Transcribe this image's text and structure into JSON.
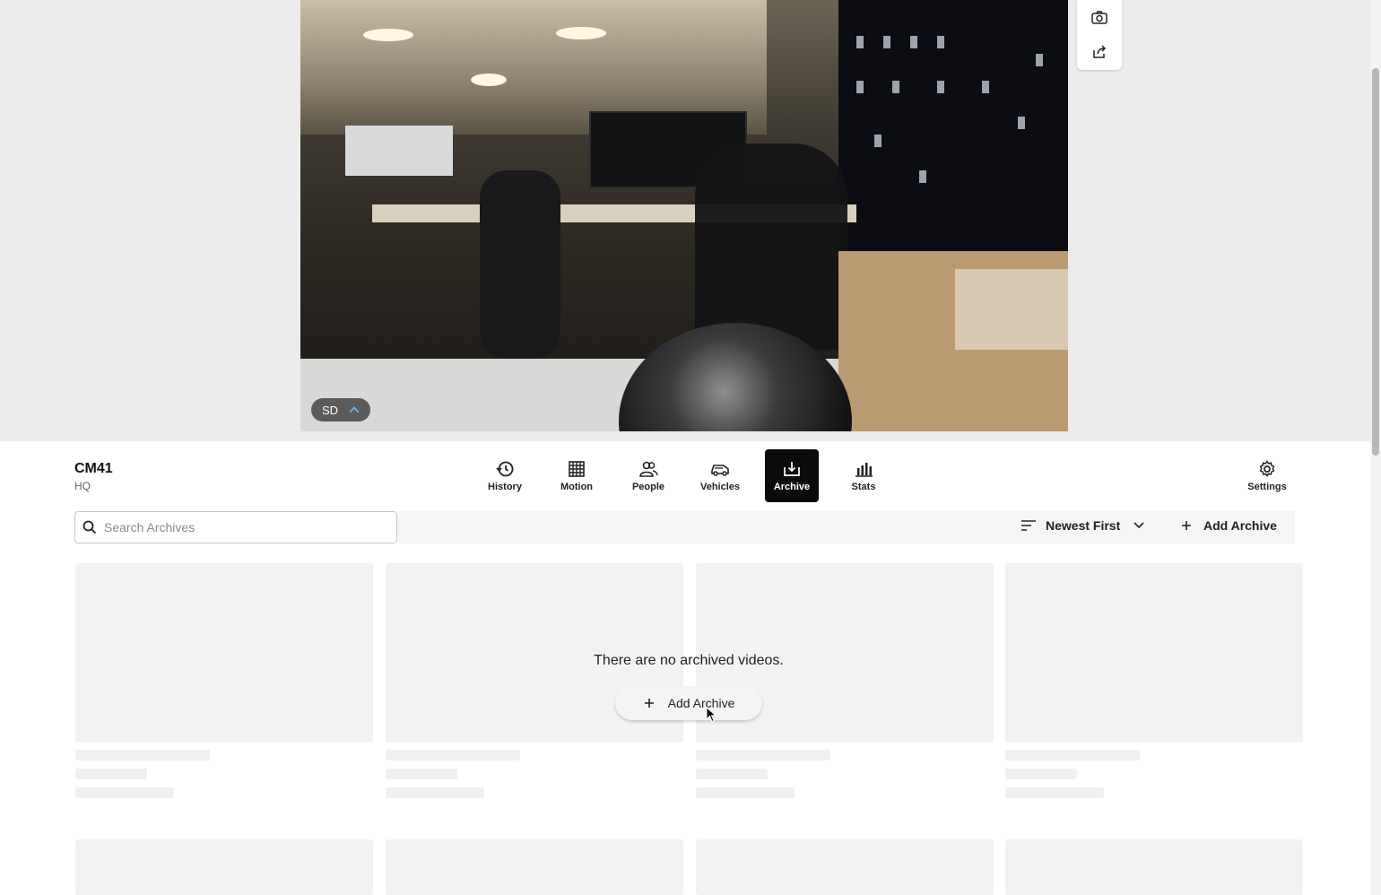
{
  "video": {
    "quality_label": "SD"
  },
  "side_tools": [
    "camera-icon",
    "share-icon"
  ],
  "camera": {
    "name": "CM41",
    "site": "HQ"
  },
  "nav": {
    "items": [
      {
        "label": "History",
        "icon": "history-icon"
      },
      {
        "label": "Motion",
        "icon": "grid-icon"
      },
      {
        "label": "People",
        "icon": "people-icon"
      },
      {
        "label": "Vehicles",
        "icon": "car-icon"
      },
      {
        "label": "Archive",
        "icon": "archive-download-icon",
        "active": true
      },
      {
        "label": "Stats",
        "icon": "bar-chart-icon"
      }
    ],
    "settings_label": "Settings"
  },
  "toolbar": {
    "search_placeholder": "Search Archives",
    "sort_label": "Newest First",
    "add_label": "Add Archive"
  },
  "empty_state": {
    "message": "There are no archived videos.",
    "button_label": "Add Archive"
  },
  "colors": {
    "active_nav_bg": "#0b0b0b",
    "skeleton": "#f2f2f2",
    "accent_chevron": "#5db3ff"
  }
}
